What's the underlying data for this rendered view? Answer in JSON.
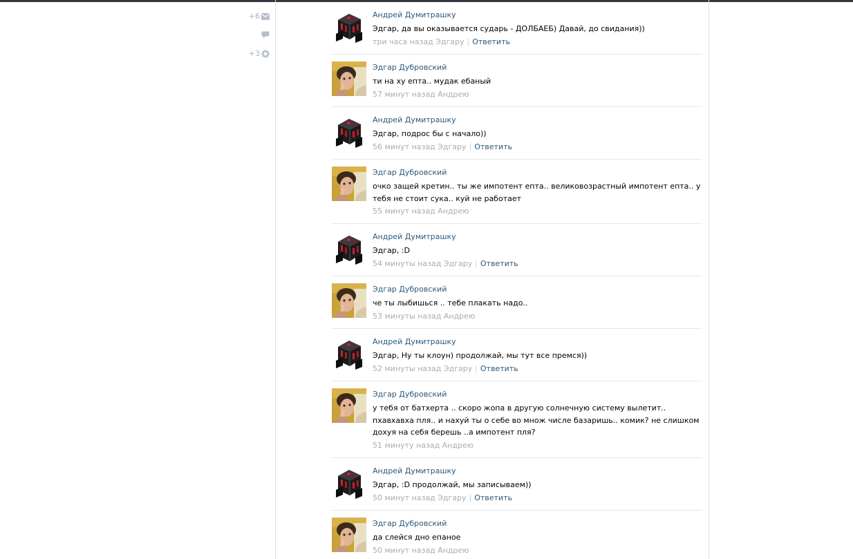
{
  "left_menu": {
    "messages_count": "+6",
    "settings_count": "+3"
  },
  "colors": {
    "link": "#2b587a",
    "meta": "#a5adb5",
    "divider": "#e4e8ec"
  },
  "comments": [
    {
      "author": "Андрей Думитрашку",
      "avatar": "black-box-avatar",
      "text": "Эдгар, да вы оказывается сударь - ДОЛБАЕБ) Давай, до свидания))",
      "meta": "три часа назад Эдгару",
      "reply": "Ответить"
    },
    {
      "author": "Эдгар Дубровский",
      "avatar": "photo-avatar",
      "text": "ти на ху епта.. мудак ебаный",
      "meta": "57 минут назад Андрею",
      "reply": ""
    },
    {
      "author": "Андрей Думитрашку",
      "avatar": "black-box-avatar",
      "text": "Эдгар, подрос бы с начало))",
      "meta": "56 минут назад Эдгару",
      "reply": "Ответить"
    },
    {
      "author": "Эдгар Дубровский",
      "avatar": "photo-avatar",
      "text": "очко защей кретин.. ты же импотент епта.. великовозрастный импотент епта.. у тебя не стоит сука.. куй не работает",
      "meta": "55 минут назад Андрею",
      "reply": ""
    },
    {
      "author": "Андрей Думитрашку",
      "avatar": "black-box-avatar",
      "text": "Эдгар, :D",
      "meta": "54 минуты назад Эдгару",
      "reply": "Ответить"
    },
    {
      "author": "Эдгар Дубровский",
      "avatar": "photo-avatar",
      "text": "че ты лыбишься .. тебе плакать надо..",
      "meta": "53 минуты назад Андрею",
      "reply": ""
    },
    {
      "author": "Андрей Думитрашку",
      "avatar": "black-box-avatar",
      "text": "Эдгар, Ну ты клоун) продолжай, мы тут все премся))",
      "meta": "52 минуты назад Эдгару",
      "reply": "Ответить"
    },
    {
      "author": "Эдгар Дубровский",
      "avatar": "photo-avatar",
      "text": "у тебя от батхерта .. скоро жопа в другую солнечную систему вылетит.. пхавхавха пля.. и нахуй ты о себе во множ числе базаришь.. комик? не слишком дохуя на себя берешь ..а импотент пля?",
      "meta": "51 минуту назад Андрею",
      "reply": ""
    },
    {
      "author": "Андрей Думитрашку",
      "avatar": "black-box-avatar",
      "text": "Эдгар, :D продолжай, мы записываем))",
      "meta": "50 минут назад Эдгару",
      "reply": "Ответить"
    },
    {
      "author": "Эдгар Дубровский",
      "avatar": "photo-avatar",
      "text": "да слейся дно епаное",
      "meta": "50 минут назад Андрею",
      "reply": ""
    }
  ]
}
